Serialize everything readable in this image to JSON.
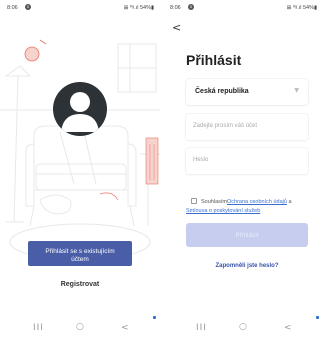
{
  "left": {
    "status": {
      "time": "8:06",
      "notif": "0",
      "right": "⊞ ⁰ᵍ.ıl 54%▮"
    },
    "login_existing_label": "Přihlásit se s existujícím účtem",
    "register_label": "Registrovat",
    "nav": {
      "recent": "III",
      "home": "○",
      "back": "<"
    }
  },
  "right": {
    "status": {
      "time": "8:06",
      "notif": "0",
      "right": "⊞ ⁰ᵍ.ıl 54%▮"
    },
    "back": "<",
    "title": "Přihlásit",
    "country": "Česká republika",
    "account_placeholder": "Zadejte prosím váš účet",
    "password_placeholder": "Heslo",
    "agree_prefix": "Souhlasím",
    "agree_link1": "Ochrana osobních údajů",
    "agree_and": " a",
    "agree_link2": "Smlouva o poskytování služeb",
    "login_label": "Přihlásit",
    "forgot_label": "Zapomněli jste heslo?",
    "nav": {
      "recent": "III",
      "home": "○",
      "back": "<"
    }
  },
  "colors": {
    "accent": "#4a5ea8",
    "button_disabled": "#c6cdef",
    "link": "#3a6fd0",
    "illustration_accent": "#e8756a"
  },
  "icons": [
    "avatar-icon",
    "chevron-down-icon",
    "back-arrow-icon",
    "checkbox-icon"
  ]
}
